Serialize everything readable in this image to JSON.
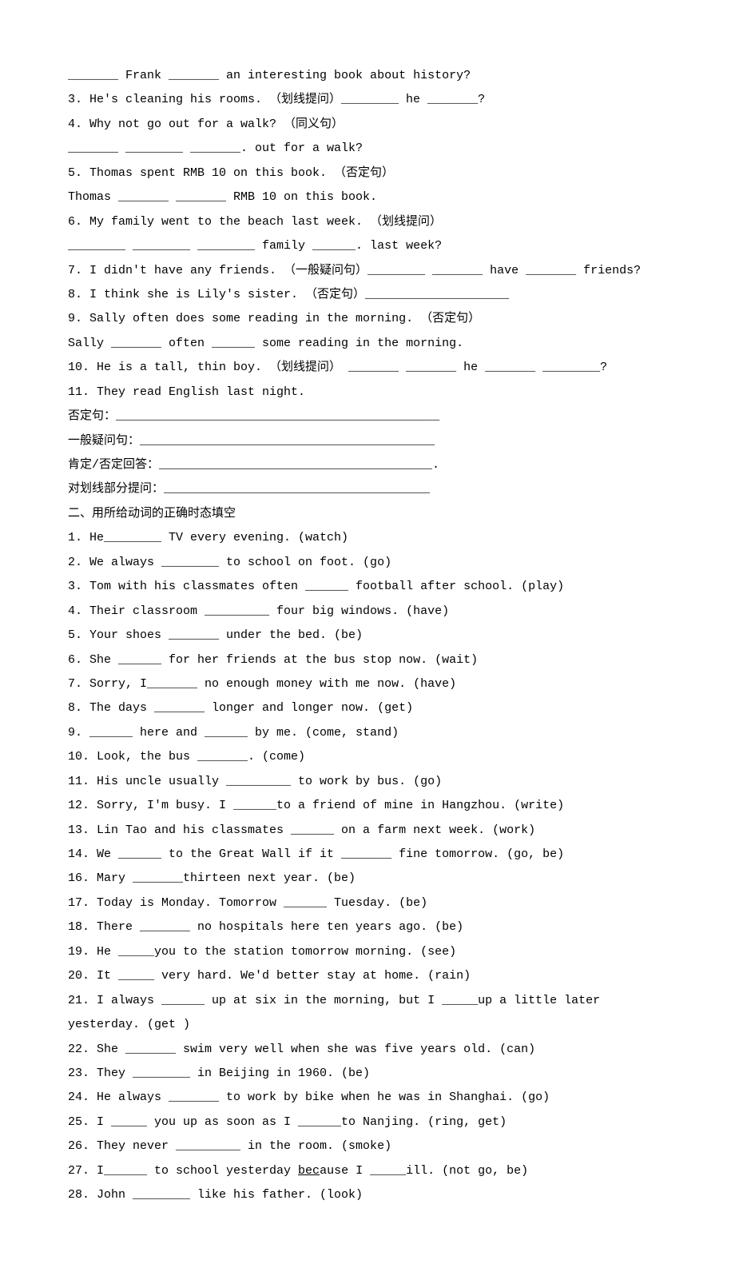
{
  "lines": [
    "_______ Frank _______ an interesting book about history?",
    "3. He's cleaning his rooms. （划线提问）________ he _______?",
    "4. Why not go out for a walk? （同义句）",
    "_______ ________ _______. out for a walk?",
    "5. Thomas spent RMB 10 on this book. （否定句）",
    "Thomas _______ _______ RMB 10 on this book.",
    "6. My family went to the beach last week. （划线提问）",
    "________ ________ ________ family ______. last week?",
    "7. I didn't have any friends. （一般疑问句）________ _______ have _______ friends?",
    "8. I think she is Lily's sister. （否定句）____________________",
    "9. Sally often does some reading in the morning. （否定句）",
    "Sally _______ often ______ some reading in the morning.",
    "10. He is a tall, thin boy. （划线提问） _______ _______ he _______ ________?",
    "11. They read English last night.",
    "否定句：_____________________________________________",
    "一般疑问句：_________________________________________",
    "肯定/否定回答：______________________________________.",
    "对划线部分提问：_____________________________________",
    "二、用所给动词的正确时态填空",
    "1. He________ TV every evening. (watch)",
    "2. We always ________ to school on foot. (go)",
    "3. Tom with his classmates often ______ football after school. (play)",
    "4. Their classroom _________ four big windows. (have)",
    "5. Your shoes _______ under the bed. (be)",
    "6. She ______ for her friends at the bus stop now. (wait)",
    "7. Sorry, I_______ no enough money with me now. (have)",
    "8. The days _______ longer and longer now. (get)",
    "9. ______ here and ______ by me. (come, stand)",
    "10. Look, the bus _______. (come)",
    "11. His uncle usually _________ to work by bus. (go)",
    "12. Sorry, I'm busy. I ______to a friend of mine in Hangzhou. (write)",
    "13. Lin Tao and his classmates ______ on a farm next week. (work)",
    "14. We ______ to the Great Wall if it _______ fine tomorrow. (go, be)",
    "16. Mary _______thirteen next year. (be)",
    "17. Today is Monday. Tomorrow ______ Tuesday. (be)",
    "18. There _______ no hospitals here ten years ago. (be)",
    "19. He _____you to the station tomorrow morning. (see)",
    "20. It _____ very hard. We'd better stay at home. (rain)",
    "21. I always ______ up at six in the morning, but I _____up a little later yesterday. (get )",
    "22. She _______ swim very well when she was five years old. (can)",
    "23. They ________ in Beijing in 1960. (be)",
    "24. He always _______ to work by bike when he was in Shanghai. (go)",
    "25. I _____ you up as soon as I ______to Nanjing. (ring, get)",
    "26. They never _________ in the room. (smoke)",
    "27. I______ to school yesterday because I _____ill. (not go, be)",
    "28. John ________ like his father. (look)"
  ]
}
